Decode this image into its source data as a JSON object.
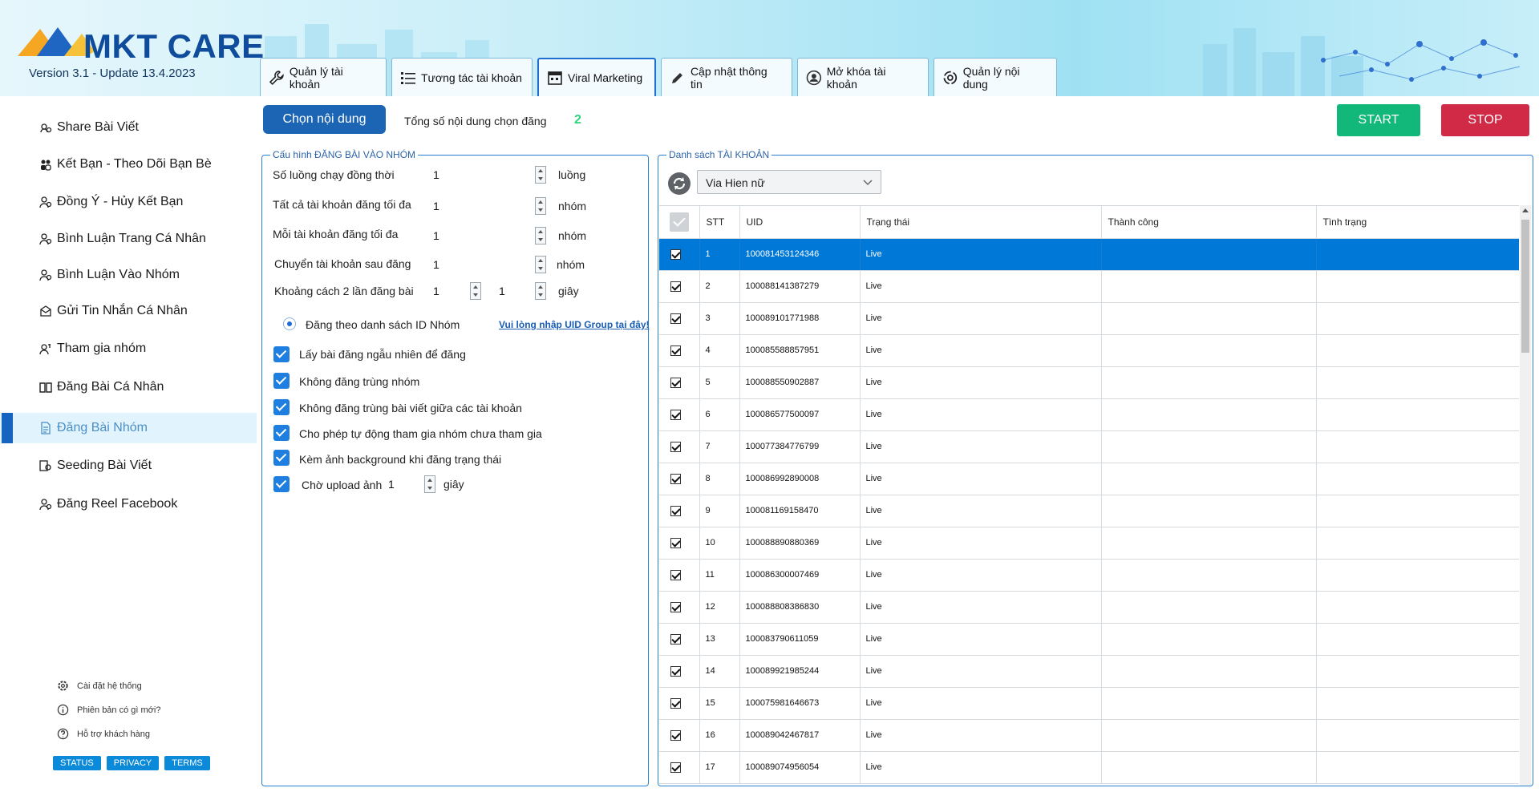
{
  "app": {
    "logo_text": "MKT CARE",
    "version": "Version 3.1 - Update 13.4.2023",
    "colors": {
      "primary": "#1c64b4",
      "start": "#12b87a",
      "stop": "#d12a47",
      "accent_count": "#2bd57b",
      "selected_row": "#0078d7"
    }
  },
  "tabs": [
    {
      "label": "Quản lý tài khoản",
      "icon": "wrench-icon"
    },
    {
      "label": "Tương tác tài khoản",
      "icon": "list-icon"
    },
    {
      "label": "Viral Marketing",
      "icon": "calendar-icon"
    },
    {
      "label": "Cập nhật thông tin",
      "icon": "pencil-icon"
    },
    {
      "label": "Mở khóa tài khoản",
      "icon": "user-circle-icon"
    },
    {
      "label": "Quản lý nội dung",
      "icon": "gear-cycle-icon"
    }
  ],
  "sidebar": {
    "items": [
      {
        "label": "Share Bài Viết"
      },
      {
        "label": "Kết Bạn - Theo Dõi Bạn Bè"
      },
      {
        "label": "Đồng Ý - Hủy Kết Bạn"
      },
      {
        "label": "Bình Luận Trang Cá Nhân"
      },
      {
        "label": "Bình Luận Vào Nhóm"
      },
      {
        "label": "Gửi Tin Nhắn Cá Nhân"
      },
      {
        "label": "Tham gia nhóm"
      },
      {
        "label": "Đăng Bài Cá Nhân"
      },
      {
        "label": "Đăng Bài Nhóm",
        "active": true
      },
      {
        "label": "Seeding Bài Viết"
      },
      {
        "label": "Đăng Reel Facebook"
      }
    ],
    "footer": {
      "settings": "Cài đặt hệ thống",
      "whats_new": "Phiên bản có gì mới?",
      "support": "Hỗ trợ khách hàng",
      "badges": [
        "STATUS",
        "PRIVACY",
        "TERMS"
      ]
    }
  },
  "toolbar": {
    "choose_content": "Chọn nội dung",
    "total_label": "Tổng số nội dung chọn đăng",
    "total_value": "2",
    "start": "START",
    "stop": "STOP"
  },
  "config": {
    "title": "Cấu hình ĐĂNG BÀI VÀO NHÓM",
    "threads_label": "Số luồng chạy đồng thời",
    "threads_value": "1",
    "threads_unit": "luồng",
    "all_max_label": "Tất cả tài khoản đăng tối đa",
    "all_max_value": "1",
    "all_max_unit": "nhóm",
    "each_max_label": "Mỗi tài khoản đăng tối đa",
    "each_max_value": "1",
    "each_max_unit": "nhóm",
    "switch_label": "Chuyển tài khoản sau đăng",
    "switch_value": "1",
    "switch_unit": "nhóm",
    "interval_label": "Khoảng cách 2 lần đăng bài",
    "interval_from": "1",
    "interval_to": "1",
    "interval_unit": "giây",
    "radio_label": "Đăng theo danh sách ID Nhóm",
    "uid_link": "Vui lòng nhập UID Group tại đây!",
    "options": [
      "Lấy bài đăng ngẫu nhiên để đăng",
      "Không đăng trùng nhóm",
      "Không đăng trùng bài viết giữa các tài khoản",
      "Cho phép tự động tham gia nhóm chưa tham gia",
      "Kèm ảnh background khi đăng trạng thái"
    ],
    "upload_wait_label": "Chờ upload ảnh",
    "upload_wait_value": "1",
    "upload_wait_unit": "giây"
  },
  "accounts": {
    "title": "Danh sách TÀI KHOẢN",
    "folder_select": "Via Hien nữ",
    "columns": [
      "STT",
      "UID",
      "Trạng thái",
      "Thành công",
      "Tình trạng"
    ],
    "rows": [
      {
        "stt": "1",
        "uid": "100081453124346",
        "status": "Live"
      },
      {
        "stt": "2",
        "uid": "100088141387279",
        "status": "Live"
      },
      {
        "stt": "3",
        "uid": "100089101771988",
        "status": "Live"
      },
      {
        "stt": "4",
        "uid": "100085588857951",
        "status": "Live"
      },
      {
        "stt": "5",
        "uid": "100088550902887",
        "status": "Live"
      },
      {
        "stt": "6",
        "uid": "100086577500097",
        "status": "Live"
      },
      {
        "stt": "7",
        "uid": "100077384776799",
        "status": "Live"
      },
      {
        "stt": "8",
        "uid": "100086992890008",
        "status": "Live"
      },
      {
        "stt": "9",
        "uid": "100081169158470",
        "status": "Live"
      },
      {
        "stt": "10",
        "uid": "100088890880369",
        "status": "Live"
      },
      {
        "stt": "11",
        "uid": "100086300007469",
        "status": "Live"
      },
      {
        "stt": "12",
        "uid": "100088808386830",
        "status": "Live"
      },
      {
        "stt": "13",
        "uid": "100083790611059",
        "status": "Live"
      },
      {
        "stt": "14",
        "uid": "100089921985244",
        "status": "Live"
      },
      {
        "stt": "15",
        "uid": "100075981646673",
        "status": "Live"
      },
      {
        "stt": "16",
        "uid": "100089042467817",
        "status": "Live"
      },
      {
        "stt": "17",
        "uid": "100089074956054",
        "status": "Live"
      }
    ]
  }
}
